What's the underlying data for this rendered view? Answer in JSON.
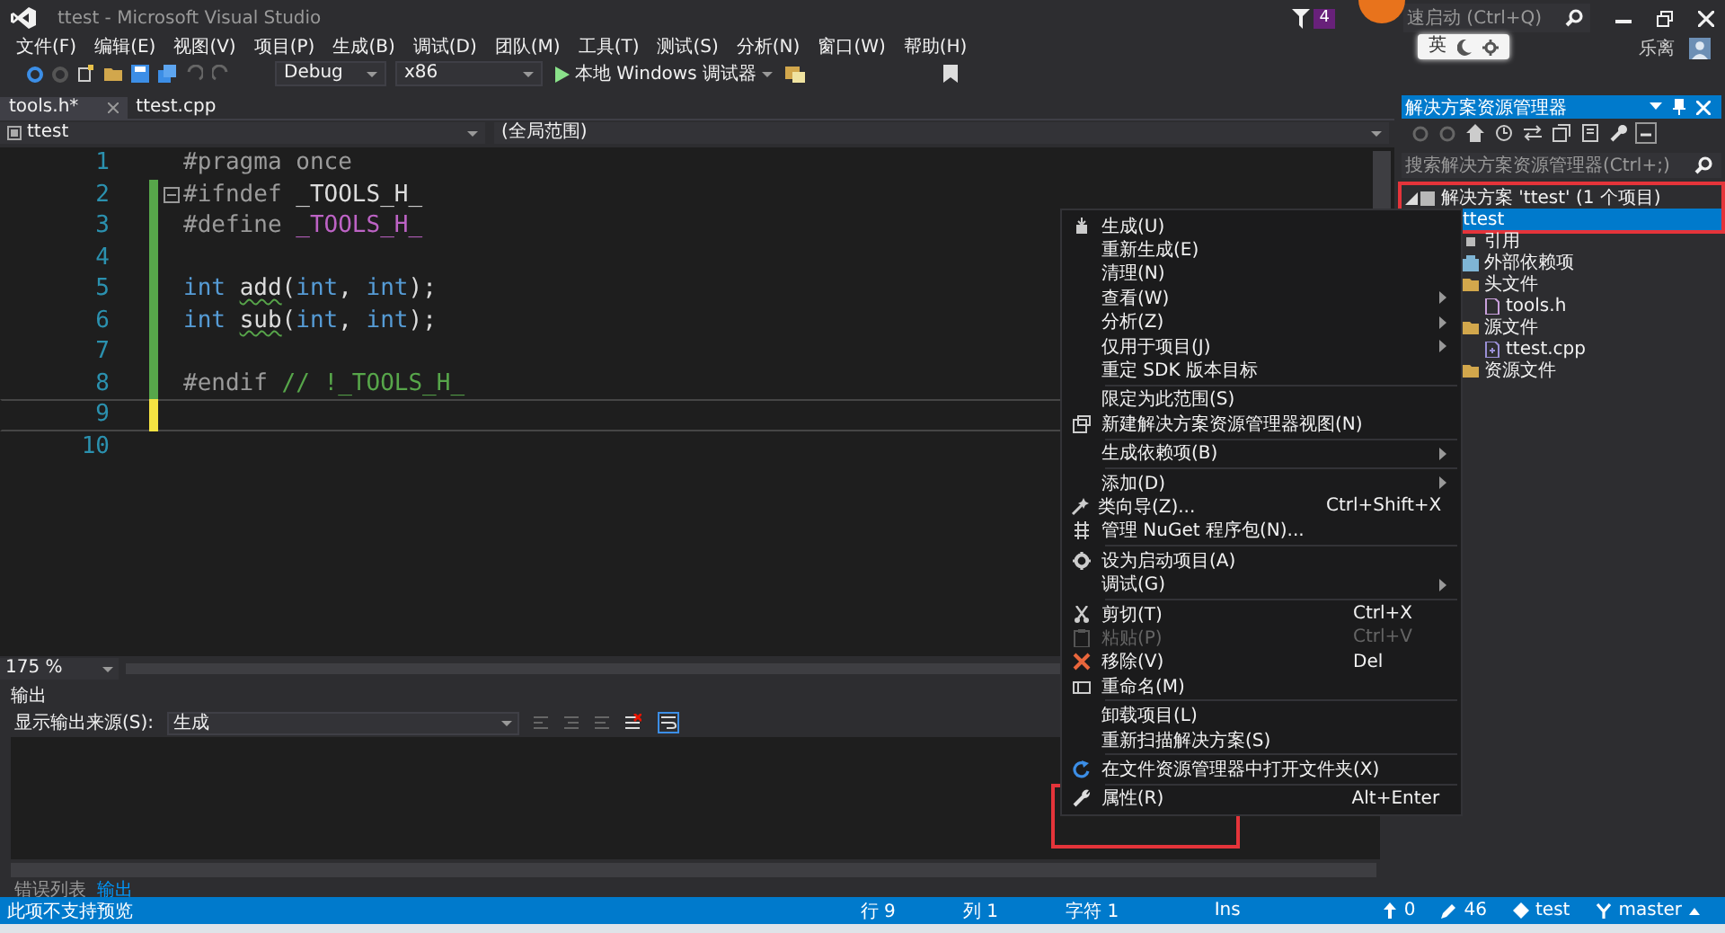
{
  "window": {
    "title": "ttest - Microsoft Visual Studio",
    "notification_count": "4",
    "quick_launch_placeholder": "速启动 (Ctrl+Q)",
    "ime": "英",
    "user": "乐离"
  },
  "menu": [
    "文件(F)",
    "编辑(E)",
    "视图(V)",
    "项目(P)",
    "生成(B)",
    "调试(D)",
    "团队(M)",
    "工具(T)",
    "测试(S)",
    "分析(N)",
    "窗口(W)",
    "帮助(H)"
  ],
  "toolbar": {
    "configuration": "Debug",
    "platform": "x86",
    "run": "本地 Windows 调试器"
  },
  "editor_tabs": [
    {
      "label": "tools.h*",
      "selected": true
    },
    {
      "label": "ttest.cpp",
      "selected": false
    }
  ],
  "navigation": {
    "project": "ttest",
    "scope": "(全局范围)"
  },
  "code_lines": [
    {
      "number": "1",
      "current": false,
      "changed": false,
      "fold_start": false,
      "tokens": [
        {
          "text": "#pragma once",
          "kind": "directive"
        }
      ]
    },
    {
      "number": "2",
      "current": false,
      "changed": true,
      "saved": true,
      "fold_start": true,
      "tokens": [
        {
          "text": "#ifndef",
          "kind": "directive"
        },
        {
          "text": " _TOOLS_H_",
          "kind": "plain"
        }
      ]
    },
    {
      "number": "3",
      "current": false,
      "changed": true,
      "saved": true,
      "fold_start": false,
      "tokens": [
        {
          "text": "#define ",
          "kind": "directive"
        },
        {
          "text": "_TOOLS_H_",
          "kind": "macro"
        }
      ]
    },
    {
      "number": "4",
      "current": false,
      "changed": true,
      "saved": true,
      "fold_start": false
    },
    {
      "number": "5",
      "current": false,
      "changed": true,
      "saved": true,
      "fold_start": false,
      "tokens": [
        {
          "text": "int ",
          "kind": "keyword"
        },
        {
          "text": "add",
          "kind": "warning"
        },
        {
          "text": "(",
          "kind": "plain"
        },
        {
          "text": "int",
          "kind": "keyword"
        },
        {
          "text": ", ",
          "kind": "plain"
        },
        {
          "text": "int",
          "kind": "keyword"
        },
        {
          "text": ");",
          "kind": "plain"
        }
      ]
    },
    {
      "number": "6",
      "current": false,
      "changed": true,
      "saved": true,
      "fold_start": false,
      "tokens": [
        {
          "text": "int ",
          "kind": "keyword"
        },
        {
          "text": "sub",
          "kind": "warning"
        },
        {
          "text": "(",
          "kind": "plain"
        },
        {
          "text": "int",
          "kind": "keyword"
        },
        {
          "text": ", ",
          "kind": "plain"
        },
        {
          "text": "int",
          "kind": "keyword"
        },
        {
          "text": ");",
          "kind": "plain"
        }
      ]
    },
    {
      "number": "7",
      "current": false,
      "changed": true,
      "saved": true,
      "fold_start": false
    },
    {
      "number": "8",
      "current": false,
      "changed": true,
      "saved": true,
      "fold_start": false,
      "tokens": [
        {
          "text": "#endif",
          "kind": "directive"
        },
        {
          "text": " // !_TOOLS_H_",
          "kind": "comment"
        }
      ]
    },
    {
      "number": "9",
      "current": true,
      "changed": true,
      "saved": false,
      "fold_start": false
    },
    {
      "number": "10",
      "current": false,
      "changed": false,
      "fold_start": false
    }
  ],
  "zoom": "175 %",
  "output": {
    "title": "输出",
    "source_label": "显示输出来源(S):",
    "source": "生成"
  },
  "bottom_tabs": [
    {
      "label": "错误列表",
      "selected": false
    },
    {
      "label": "输出",
      "selected": true
    }
  ],
  "context_menu": [
    {
      "kind": "build",
      "label": "生成(U)",
      "submenu": false,
      "disabled": false
    },
    {
      "kind": "plain",
      "label": "重新生成(E)",
      "submenu": false,
      "disabled": false
    },
    {
      "kind": "plain",
      "label": "清理(N)",
      "submenu": false,
      "disabled": false
    },
    {
      "kind": "plain",
      "label": "查看(W)",
      "submenu": true,
      "disabled": false
    },
    {
      "kind": "plain",
      "label": "分析(Z)",
      "submenu": true,
      "disabled": false
    },
    {
      "kind": "plain",
      "label": "仅用于项目(J)",
      "submenu": true,
      "disabled": false
    },
    {
      "kind": "plain",
      "label": "重定 SDK 版本目标",
      "submenu": false,
      "disabled": false
    },
    {
      "kind": "separator"
    },
    {
      "kind": "plain",
      "label": "限定为此范围(S)",
      "submenu": false,
      "disabled": false
    },
    {
      "kind": "windows",
      "label": "新建解决方案资源管理器视图(N)",
      "submenu": false,
      "disabled": false
    },
    {
      "kind": "separator"
    },
    {
      "kind": "plain",
      "label": "生成依赖项(B)",
      "submenu": true,
      "disabled": false
    },
    {
      "kind": "separator"
    },
    {
      "kind": "plain",
      "label": "添加(D)",
      "submenu": true,
      "disabled": false
    },
    {
      "kind": "wand",
      "label": "类向导(Z)...",
      "shortcut": "Ctrl+Shift+X",
      "submenu": false,
      "disabled": false
    },
    {
      "kind": "grid",
      "label": "管理 NuGet 程序包(N)...",
      "submenu": false,
      "disabled": false
    },
    {
      "kind": "separator"
    },
    {
      "kind": "gear",
      "label": "设为启动项目(A)",
      "submenu": false,
      "disabled": false
    },
    {
      "kind": "plain",
      "label": "调试(G)",
      "submenu": true,
      "disabled": false
    },
    {
      "kind": "separator"
    },
    {
      "kind": "scissors",
      "label": "剪切(T)",
      "shortcut": "Ctrl+X",
      "submenu": false,
      "disabled": false
    },
    {
      "kind": "clipboard",
      "label": "粘贴(P)",
      "shortcut": "Ctrl+V",
      "submenu": false,
      "disabled": true
    },
    {
      "kind": "cross",
      "label": "移除(V)",
      "shortcut": "Del",
      "submenu": false,
      "disabled": false
    },
    {
      "kind": "rename",
      "label": "重命名(M)",
      "submenu": false,
      "disabled": false
    },
    {
      "kind": "separator"
    },
    {
      "kind": "plain",
      "label": "卸载项目(L)",
      "submenu": false,
      "disabled": false
    },
    {
      "kind": "plain",
      "label": "重新扫描解决方案(S)",
      "submenu": false,
      "disabled": false
    },
    {
      "kind": "separator"
    },
    {
      "kind": "refresh",
      "label": "在文件资源管理器中打开文件夹(X)",
      "submenu": false,
      "disabled": false
    },
    {
      "kind": "separator"
    },
    {
      "kind": "wrench",
      "label": "属性(R)",
      "shortcut": "Alt+Enter",
      "submenu": false,
      "disabled": false
    }
  ],
  "solution_explorer": {
    "title": "解决方案资源管理器",
    "search_placeholder": "搜索解决方案资源管理器(Ctrl+;)",
    "tree": [
      {
        "kind": "solution",
        "label": "解决方案 'ttest' (1 个项目)",
        "selected": false,
        "expanded": true,
        "children": [
          {
            "label": "ttest",
            "selected": true,
            "children": [
              {
                "kind": "references",
                "label": "引用",
                "selected": false
              },
              {
                "kind": "dependencies",
                "label": "外部依赖项",
                "selected": false
              },
              {
                "kind": "folder",
                "label": "头文件",
                "selected": false,
                "children": [
                  {
                    "kind": "header",
                    "label": "tools.h",
                    "selected": false
                  }
                ]
              },
              {
                "kind": "folder",
                "label": "源文件",
                "selected": false,
                "children": [
                  {
                    "kind": "source",
                    "label": "ttest.cpp",
                    "selected": false
                  }
                ]
              },
              {
                "kind": "folder",
                "label": "资源文件",
                "selected": false
              }
            ]
          }
        ]
      }
    ]
  },
  "status_bar": {
    "message": "此项不支持预览",
    "line": "行 9",
    "column": "列 1",
    "char": "字符 1",
    "mode": "Ins",
    "pending": "0",
    "edits": "46",
    "repo": "test",
    "branch": "master"
  }
}
